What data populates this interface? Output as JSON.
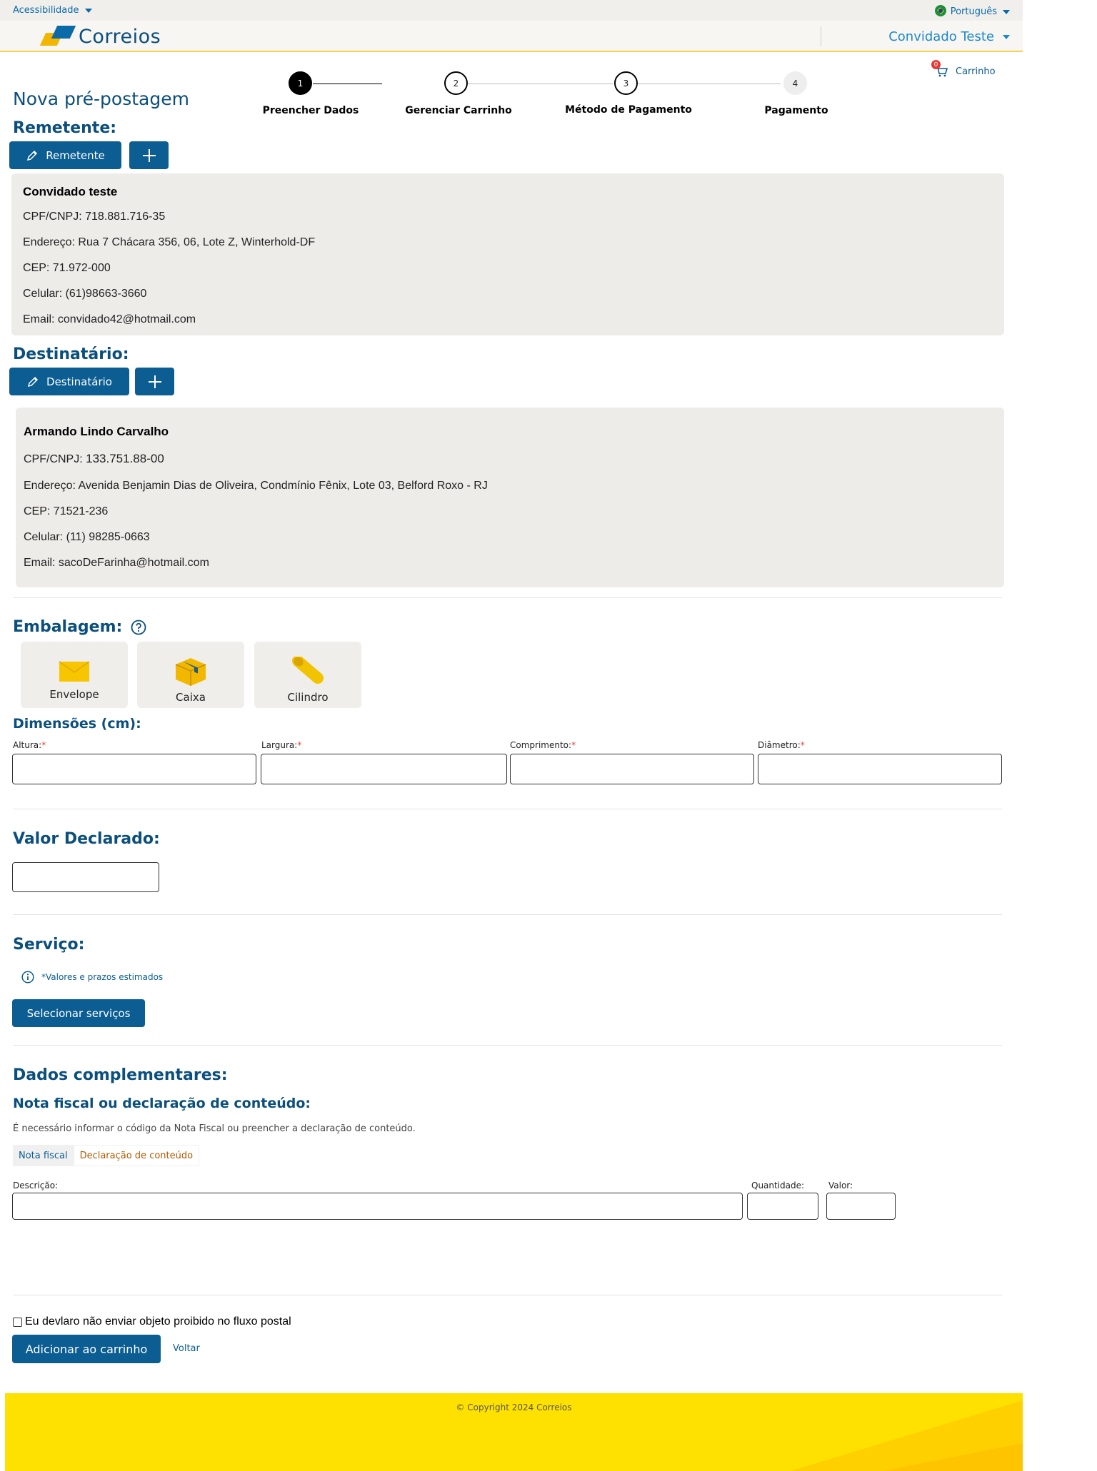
{
  "topbar": {
    "accessibility": "Acessibilidade",
    "language": "Português"
  },
  "header": {
    "brand": "Correios",
    "user": "Convidado Teste",
    "cart_label": "Carrinho",
    "cart_count": "0"
  },
  "page": {
    "title": "Nova pré-postagem"
  },
  "stepper": {
    "steps": [
      {
        "number": "1",
        "label": "Preencher Dados"
      },
      {
        "number": "2",
        "label": "Gerenciar Carrinho"
      },
      {
        "number": "3",
        "label": "Método de Pagamento"
      },
      {
        "number": "4",
        "label": "Pagamento"
      }
    ]
  },
  "sender": {
    "heading": "Remetente:",
    "edit_button": "Remetente",
    "name": "Convidado teste",
    "cpf": "CPF/CNPJ: 718.881.716-35",
    "address": "Endereço: Rua 7 Chácara 356, 06, Lote Z, Winterhold-DF",
    "cep": "CEP: 71.972-000",
    "phone": "Celular: (61)98663-3660",
    "email": "Email: convidado42@hotmail.com"
  },
  "recipient": {
    "heading": "Destinatário:",
    "edit_button": "Destinatário",
    "name": "Armando Lindo Carvalho",
    "cpf_label": "CPF/CNPJ: ",
    "cpf_value": "133.751.88-00",
    "address": "Endereço:  Avenida Benjamin Dias de Oliveira, Condmínio Fênix, Lote 03, Belford Roxo - RJ",
    "cep": "CEP: 71521-236",
    "phone": "Celular: (11) 98285-0663",
    "email": "Email: sacoDeFarinha@hotmail.com"
  },
  "packaging": {
    "heading": "Embalagem:",
    "options": [
      {
        "label": "Envelope",
        "icon": "envelope-icon"
      },
      {
        "label": "Caixa",
        "icon": "box-icon"
      },
      {
        "label": "Cilindro",
        "icon": "cylinder-icon"
      }
    ]
  },
  "dimensions": {
    "heading": "Dimensões (cm):",
    "fields": [
      {
        "label": "Altura:",
        "required": "*"
      },
      {
        "label": "Largura:",
        "required": "*"
      },
      {
        "label": "Comprimento:",
        "required": "*"
      },
      {
        "label": "Diâmetro:",
        "required": "*"
      }
    ]
  },
  "declared_value": {
    "heading": "Valor Declarado:"
  },
  "service": {
    "heading": "Serviço:",
    "note": "*Valores e prazos estimados",
    "select_button": "Selecionar serviços"
  },
  "complementary": {
    "heading": "Dados complementares:",
    "subheading": "Nota fiscal ou declaração de conteúdo:",
    "hint": "É necessário informar o código da Nota Fiscal ou preencher a declaração de conteúdo.",
    "tabs": [
      "Nota fiscal",
      "Declaração de conteúdo"
    ],
    "fields": {
      "description": "Descrição:",
      "quantity": "Quantidade:",
      "value": "Valor:"
    }
  },
  "declaration": {
    "checkbox_label": "Eu devlaro não enviar objeto proibido no fluxo postal"
  },
  "actions": {
    "add_to_cart": "Adicionar ao carrinho",
    "back": "Voltar"
  },
  "footer": {
    "copyright": "© Copyright 2024 Correios"
  },
  "colors": {
    "primary": "#0b5d92",
    "heading": "#0b4f7c",
    "footer": "#ffe100",
    "card": "#edece9"
  }
}
